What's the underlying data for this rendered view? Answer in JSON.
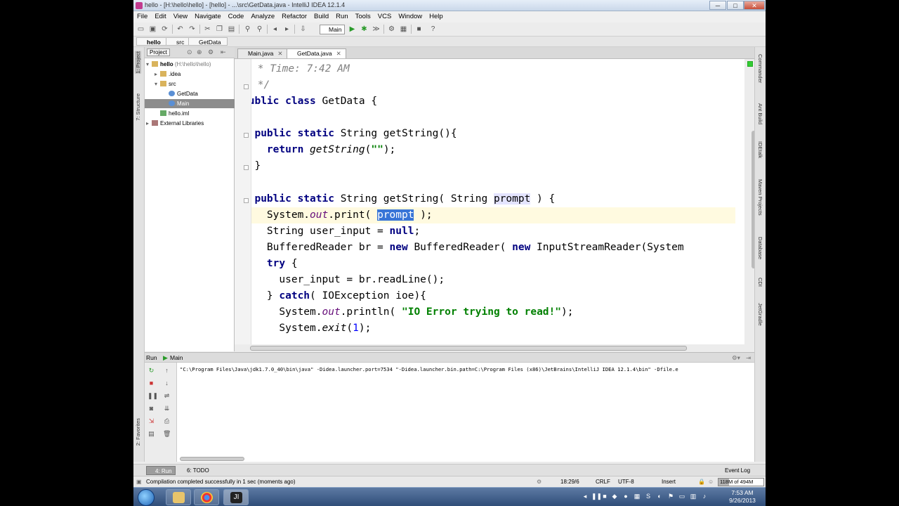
{
  "window": {
    "title": "hello - [H:\\hello\\hello] - [hello] - ...\\src\\GetData.java - IntelliJ IDEA 12.1.4",
    "minimize": "─",
    "maximize": "□",
    "close": "✕"
  },
  "menu": [
    "File",
    "Edit",
    "View",
    "Navigate",
    "Code",
    "Analyze",
    "Refactor",
    "Build",
    "Run",
    "Tools",
    "VCS",
    "Window",
    "Help"
  ],
  "toolbar": {
    "run_config": "Main",
    "help": "?"
  },
  "breadcrumb": [
    "hello",
    "src",
    "GetData"
  ],
  "left_strip": {
    "project_tab": "1: Project",
    "structure_tab": "7: Structure",
    "favorites_tab": "2: Favorites"
  },
  "project": {
    "tab_label": "Project",
    "tree": [
      {
        "label": "hello",
        "suffix": " (H:\\hello\\hello)",
        "icon": "folder-icon"
      },
      {
        "label": ".idea",
        "icon": "folder-icon"
      },
      {
        "label": "src",
        "icon": "folder-icon"
      },
      {
        "label": "GetData",
        "icon": "class-icon"
      },
      {
        "label": "Main",
        "icon": "class-icon"
      },
      {
        "label": "hello.iml",
        "icon": "module-file-icon"
      },
      {
        "label": "External Libraries",
        "icon": "library-icon"
      }
    ]
  },
  "editor_tabs": [
    {
      "label": "Main.java",
      "active": false
    },
    {
      "label": "GetData.java",
      "active": true
    }
  ],
  "code": {
    "l1": " * Time: 7:42 AM",
    "l2": " */",
    "l3a": "public class ",
    "l3b": "GetData {",
    "l4a": "  public static ",
    "l4b": "String getString(){",
    "l5a": "    return ",
    "l5b": "getString",
    "l5c": "(",
    "l5d": "\"\"",
    "l5e": ");",
    "l6": "  }",
    "l7a": "  public static ",
    "l7b": "String getString( String ",
    "l7c": "prompt",
    "l7d": " ) {",
    "l8a": "    System.",
    "l8b": "out",
    "l8c": ".print( ",
    "l8d": "prompt",
    "l8e": " );",
    "l9a": "    String user_input = ",
    "l9b": "null",
    "l9c": ";",
    "l10a": "    BufferedReader br = ",
    "l10b": "new",
    "l10c": " BufferedReader( ",
    "l10d": "new",
    "l10e": " InputStreamReader(System",
    "l11a": "    ",
    "l11b": "try",
    "l11c": " {",
    "l12": "      user_input = br.readLine();",
    "l13a": "    } ",
    "l13b": "catch",
    "l13c": "( IOException ioe){",
    "l14a": "      System.",
    "l14b": "out",
    "l14c": ".println( ",
    "l14d": "\"IO Error trying to read!\"",
    "l14e": ");",
    "l15a": "      System.",
    "l15b": "exit",
    "l15c": "(",
    "l15d": "1",
    "l15e": ");"
  },
  "right_strip": [
    "Commander",
    "Ant Build",
    "IDEtalk",
    "Maven Projects",
    "Database",
    "CDI",
    "JetGradle"
  ],
  "run_panel": {
    "header_run": "Run",
    "header_config": "Main",
    "console_line": "\"C:\\Program Files\\Java\\jdk1.7.0_40\\bin\\java\" -Didea.launcher.port=7534 \"-Didea.launcher.bin.path=C:\\Program Files (x86)\\JetBrains\\IntelliJ IDEA 12.1.4\\bin\" -Dfile.e"
  },
  "bottom_tabs": {
    "run": "4: Run",
    "todo": "6: TODO",
    "event_log": "Event Log"
  },
  "status": {
    "message": "Compilation completed successfully in 1 sec (moments ago)",
    "position": "18:29/6",
    "line_sep": "CRLF",
    "encoding": "UTF-8",
    "insert_mode": "Insert",
    "memory": "118M of 494M",
    "memory_used_fraction": 0.24
  },
  "taskbar": {
    "time": "7:53 AM",
    "date": "9/26/2013"
  },
  "colors": {
    "keyword": "#000080",
    "string": "#008000",
    "comment": "#808080",
    "static_field": "#660e7a",
    "number": "#0000ff"
  }
}
